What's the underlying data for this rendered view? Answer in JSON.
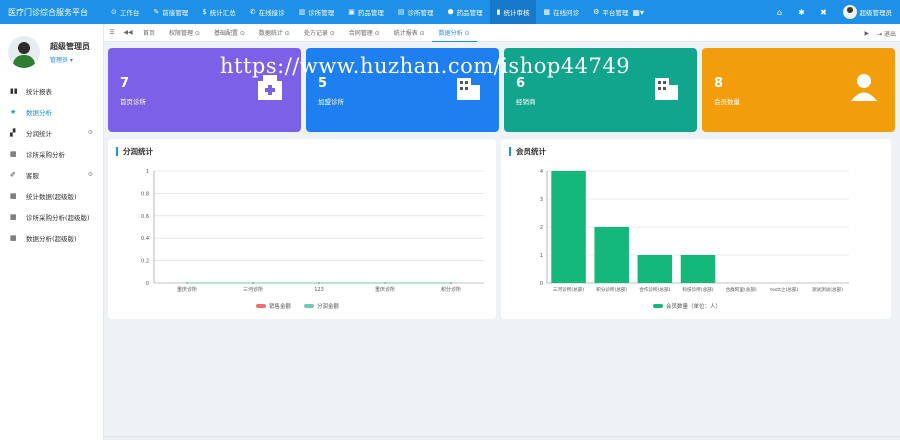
{
  "brand": "医疗门诊综合服务平台",
  "top_nav": [
    {
      "label": "工作台",
      "icon": "dashboard-icon",
      "glyph": "⊙"
    },
    {
      "label": "前接管理",
      "icon": "pen-icon",
      "glyph": "✎"
    },
    {
      "label": "统计汇总",
      "icon": "dollar-icon",
      "glyph": "$"
    },
    {
      "label": "在线接诊",
      "icon": "phone-icon",
      "glyph": "✆"
    },
    {
      "label": "诊所管理",
      "icon": "bank-icon",
      "glyph": "▥"
    },
    {
      "label": "药品管理",
      "icon": "box-icon",
      "glyph": "▣"
    },
    {
      "label": "诊所管理",
      "icon": "hospital-icon",
      "glyph": "▤"
    },
    {
      "label": "药品管理",
      "icon": "pill-icon",
      "glyph": "⬢"
    },
    {
      "label": "统计审核",
      "icon": "bar-chart-icon",
      "glyph": "▮"
    },
    {
      "label": "在线问诊",
      "icon": "chat-icon",
      "glyph": "▩"
    },
    {
      "label": "平台管理",
      "icon": "gear-icon",
      "glyph": "⚙"
    }
  ],
  "top_nav_active": 8,
  "top_more": "▦▾",
  "top_icons": [
    {
      "name": "home-icon",
      "glyph": "⌂"
    },
    {
      "name": "settings-icon",
      "glyph": "✱"
    },
    {
      "name": "fullscreen-icon",
      "glyph": "✖"
    }
  ],
  "top_user": "超级管理员",
  "profile": {
    "name": "超级管理员",
    "role": "管理员 ▾"
  },
  "sidebar": [
    {
      "label": "统计报表",
      "icon": "bars-icon",
      "glyph": "▮▮",
      "caret": ""
    },
    {
      "label": "数据分析",
      "icon": "star-icon",
      "glyph": "★",
      "caret": ""
    },
    {
      "label": "分润统计",
      "icon": "road-icon",
      "glyph": "▞",
      "caret": "⚙"
    },
    {
      "label": "诊所采购分析",
      "icon": "table-icon",
      "glyph": "▦",
      "caret": ""
    },
    {
      "label": "客服",
      "icon": "edit-icon",
      "glyph": "✐",
      "caret": "⚙"
    },
    {
      "label": "统计数据(超级版)",
      "icon": "table-icon",
      "glyph": "▦",
      "caret": ""
    },
    {
      "label": "诊所采购分析(超级版)",
      "icon": "table-icon",
      "glyph": "▦",
      "caret": ""
    },
    {
      "label": "数据分析(超级版)",
      "icon": "table-icon",
      "glyph": "▦",
      "caret": ""
    }
  ],
  "sidebar_active": 1,
  "tabs": [
    "首页",
    "权限管理 ⊙",
    "基础配置 ⊙",
    "数据统计 ⊙",
    "处方记录 ⊙",
    "合同管理 ⊙",
    "统计报表 ⊙",
    "数据分析 ⊙"
  ],
  "tabs_active": 7,
  "tab_left_icons": [
    "☰",
    "◀◀"
  ],
  "tab_right": {
    "next": "▶",
    "logout": "⇥ 退出"
  },
  "cards": [
    {
      "value": "7",
      "label": "首页诊所",
      "color": "#7b61e8",
      "icon": "clinic-icon"
    },
    {
      "value": "5",
      "label": "加盟诊所",
      "color": "#1e7ff0",
      "icon": "building-icon"
    },
    {
      "value": "6",
      "label": "经销商",
      "color": "#12a58e",
      "icon": "building-icon"
    },
    {
      "value": "8",
      "label": "会员数量",
      "color": "#f29d0c",
      "icon": "person-icon"
    }
  ],
  "watermark": "https://www.huzhan.com/ishop44749",
  "chart_left": {
    "title": "分润统计",
    "type": "line",
    "categories": [
      "重庆诊所",
      "三河诊所",
      "123",
      "重庆诊所",
      "积分诊所"
    ],
    "series": [
      {
        "name": "销售金额",
        "values": [
          0,
          0,
          0,
          0,
          0
        ],
        "color": "#e8716d"
      },
      {
        "name": "分润金额",
        "values": [
          0,
          0,
          0,
          0,
          0
        ],
        "color": "#73c9b4"
      }
    ],
    "ylim": [
      0,
      1
    ],
    "yticks": [
      "0",
      "0.2",
      "0.4",
      "0.6",
      "0.8",
      "1"
    ]
  },
  "chart_right": {
    "title": "会员统计",
    "type": "bar",
    "categories": [
      "三河诊所(总部)",
      "积分诊所(总部)",
      "合作诊所(总部)",
      "科技诊所(总部)",
      "合群阿里(总部)",
      "testt之(总部)",
      "测试测试(总部)"
    ],
    "series": [
      {
        "name": "会员数量（单位：人）",
        "values": [
          4,
          2,
          1,
          1,
          0,
          0,
          0
        ],
        "color": "#14b87a"
      }
    ],
    "ylim": [
      0,
      4
    ],
    "yticks": [
      "0",
      "1",
      "2",
      "3",
      "4"
    ]
  }
}
